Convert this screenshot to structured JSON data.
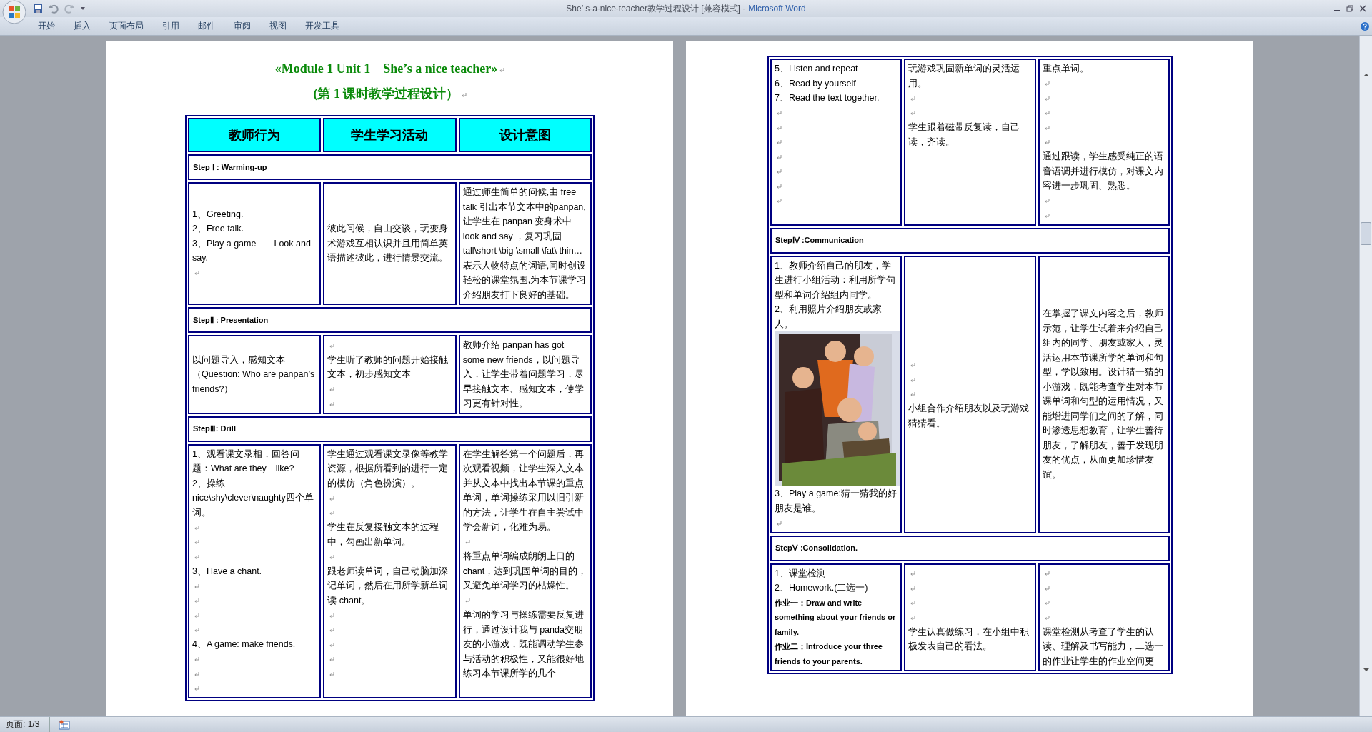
{
  "title_bar": {
    "document_title": "She’  s-a-nice-teacher教学过程设计 [兼容模式] -",
    "app_name": "Microsoft Word"
  },
  "ribbon_tabs": [
    {
      "label": "开始",
      "selected": false
    },
    {
      "label": "插入",
      "selected": false
    },
    {
      "label": "页面布局",
      "selected": false
    },
    {
      "label": "引用",
      "selected": false
    },
    {
      "label": "邮件",
      "selected": false
    },
    {
      "label": "审阅",
      "selected": false
    },
    {
      "label": "视图",
      "selected": false
    },
    {
      "label": "开发工具",
      "selected": false
    }
  ],
  "pages": [
    {
      "heading": [
        "«Module 1 Unit 1　She’s a nice teacher»",
        "(第 1 课时教学过程设计）"
      ],
      "table": {
        "columns": [
          "教师行为",
          "学生学习活动",
          "设计意图"
        ],
        "rows": [
          {
            "kind": "step",
            "text": "Step Ⅰ : Warming-up"
          },
          {
            "kind": "centered",
            "cells": [
              [
                {
                  "kind": "text",
                  "text": "1、Greeting."
                },
                {
                  "kind": "text",
                  "text": "2、Free talk."
                },
                {
                  "kind": "text",
                  "text": "3、Play a game——Look and say."
                },
                {
                  "kind": "blank"
                }
              ],
              [
                {
                  "kind": "text",
                  "text": "彼此问候，自由交谈，玩变身术游戏互相认识并且用简单英语描述彼此，进行情景交流。"
                }
              ],
              [
                {
                  "kind": "text",
                  "text": "通过师生简单的问候,由 free talk 引出本节文本中的panpan,让学生在 panpan 变身术中 look and say ，复习巩固 tall\\short \\big \\small \\fat\\ thin…表示人物特点的词语,同时创设轻松的课堂氛围,为本节课学习介绍朋友打下良好的基础。"
                }
              ]
            ]
          },
          {
            "kind": "step",
            "text": "StepⅡ : Presentation"
          },
          {
            "kind": "centered",
            "cells": [
              [
                {
                  "kind": "text",
                  "text": "以问题导入，感知文本（Question: Who are panpan’s friends?）"
                }
              ],
              [
                {
                  "kind": "blank"
                },
                {
                  "kind": "text",
                  "text": "学生听了教师的问题开始接触文本，初步感知文本"
                },
                {
                  "kind": "blank"
                },
                {
                  "kind": "blank"
                }
              ],
              [
                {
                  "kind": "text",
                  "text": "教师介绍 panpan has got some new friends，以问题导入，让学生带着问题学习，尽早接触文本、感知文本，使学习更有针对性。"
                }
              ]
            ]
          },
          {
            "kind": "step",
            "text": "StepⅢ: Drill"
          },
          {
            "kind": "content",
            "cells": [
              [
                {
                  "kind": "text",
                  "text": "1、观看课文录相，回答问题：What are they　like?"
                },
                {
                  "kind": "text",
                  "text": "2、操练 nice\\shy\\clever\\naughty四个单词。"
                },
                {
                  "kind": "blank"
                },
                {
                  "kind": "blank"
                },
                {
                  "kind": "blank"
                },
                {
                  "kind": "text",
                  "text": "3、Have a chant."
                },
                {
                  "kind": "blank"
                },
                {
                  "kind": "blank"
                },
                {
                  "kind": "blank"
                },
                {
                  "kind": "blank"
                },
                {
                  "kind": "text",
                  "text": "4、A game: make friends."
                },
                {
                  "kind": "blank"
                },
                {
                  "kind": "blank"
                },
                {
                  "kind": "blank"
                }
              ],
              [
                {
                  "kind": "text",
                  "text": "学生通过观看课文录像等教学资源，根据所看到的进行一定的模仿（角色扮演）。"
                },
                {
                  "kind": "blank"
                },
                {
                  "kind": "blank"
                },
                {
                  "kind": "text",
                  "text": "学生在反复接触文本的过程中，勾画出新单词。"
                },
                {
                  "kind": "blank"
                },
                {
                  "kind": "text",
                  "text": "跟老师读单词，自己动脑加深记单词，然后在用所学新单词读 chant。"
                },
                {
                  "kind": "blank"
                },
                {
                  "kind": "blank"
                },
                {
                  "kind": "blank"
                },
                {
                  "kind": "blank"
                },
                {
                  "kind": "blank"
                }
              ],
              [
                {
                  "kind": "text",
                  "text": "在学生解答第一个问题后，再次观看视频，让学生深入文本并从文本中找出本节课的重点单词，单词操练采用以旧引新的方法，让学生在自主尝试中学会新词，化难为易。"
                },
                {
                  "kind": "blank"
                },
                {
                  "kind": "text",
                  "text": "将重点单词编成朗朗上口的chant，达到巩固单词的目的，又避免单词学习的枯燥性。"
                },
                {
                  "kind": "blank"
                },
                {
                  "kind": "text",
                  "text": "单词的学习与操练需要反复进行，通过设计我与 panda交朋友的小游戏，既能调动学生参与活动的积极性，又能很好地练习本节课所学的几个"
                }
              ]
            ]
          }
        ]
      }
    },
    {
      "table": {
        "rows": [
          {
            "kind": "content",
            "cells": [
              [
                {
                  "kind": "text",
                  "text": "5、Listen and repeat"
                },
                {
                  "kind": "text",
                  "text": "6、Read by yourself"
                },
                {
                  "kind": "text",
                  "text": "7、Read the text together."
                },
                {
                  "kind": "blank"
                },
                {
                  "kind": "blank"
                },
                {
                  "kind": "blank"
                },
                {
                  "kind": "blank"
                },
                {
                  "kind": "blank"
                },
                {
                  "kind": "blank"
                },
                {
                  "kind": "blank"
                }
              ],
              [
                {
                  "kind": "text",
                  "text": "玩游戏巩固新单词的灵活运用。"
                },
                {
                  "kind": "blank"
                },
                {
                  "kind": "blank"
                },
                {
                  "kind": "text",
                  "text": "学生跟着磁带反复读，自己读，齐读。"
                }
              ],
              [
                {
                  "kind": "text",
                  "text": "重点单词。"
                },
                {
                  "kind": "blank"
                },
                {
                  "kind": "blank"
                },
                {
                  "kind": "blank"
                },
                {
                  "kind": "blank"
                },
                {
                  "kind": "blank"
                },
                {
                  "kind": "text",
                  "text": "通过跟读，学生感受纯正的语音语调并进行模仿，对课文内容进一步巩固、熟悉。"
                },
                {
                  "kind": "blank"
                },
                {
                  "kind": "blank"
                }
              ]
            ]
          },
          {
            "kind": "step",
            "text": "StepⅣ :Communication"
          },
          {
            "kind": "centered",
            "cells": [
              [
                {
                  "kind": "text",
                  "text": "1、教师介绍自己的朋友，学生进行小组活动：利用所学句型和单词介绍组内同学。"
                },
                {
                  "kind": "text",
                  "text": "2、利用照片介绍朋友或家人。"
                },
                {
                  "kind": "picture"
                },
                {
                  "kind": "text",
                  "text": "3、Play a game:猜一猜我的好朋友是谁。"
                },
                {
                  "kind": "blank"
                }
              ],
              [
                {
                  "kind": "blank"
                },
                {
                  "kind": "blank"
                },
                {
                  "kind": "blank"
                },
                {
                  "kind": "text",
                  "text": "小组合作介绍朋友以及玩游戏猜猜看。"
                }
              ],
              [
                {
                  "kind": "text",
                  "text": "在掌握了课文内容之后，教师示范，让学生试着来介绍自己组内的同学、朋友或家人，灵活运用本节课所学的单词和句型，学以致用。设计猜一猜的小游戏，既能考查学生对本节课单词和句型的运用情况，又能增进同学们之间的了解，同时渗透思想教育，让学生善待朋友，了解朋友，善于发现朋友的优点，从而更加珍惜友谊。"
                }
              ]
            ]
          },
          {
            "kind": "step",
            "text": "StepⅤ :Consolidation."
          },
          {
            "kind": "content",
            "cells": [
              [
                {
                  "kind": "text",
                  "text": "1、课堂检测"
                },
                {
                  "kind": "text",
                  "text": "2、Homework.(二选一)"
                },
                {
                  "kind": "bold",
                  "text": "作业一：Draw and write something about your friends or family."
                },
                {
                  "kind": "bold",
                  "text": "作业二：Introduce your three friends to your parents."
                }
              ],
              [
                {
                  "kind": "blank"
                },
                {
                  "kind": "blank"
                },
                {
                  "kind": "blank"
                },
                {
                  "kind": "blank"
                },
                {
                  "kind": "text",
                  "text": "学生认真做练习，在小组中积极发表自己的看法。"
                }
              ],
              [
                {
                  "kind": "blank"
                },
                {
                  "kind": "blank"
                },
                {
                  "kind": "blank"
                },
                {
                  "kind": "blank"
                },
                {
                  "kind": "text",
                  "text": "课堂检测从考查了学生的认读、理解及书写能力，二选一的作业让学生的作业空间更"
                }
              ]
            ]
          }
        ]
      }
    }
  ],
  "status_bar": {
    "page": "页面: 1/3"
  }
}
